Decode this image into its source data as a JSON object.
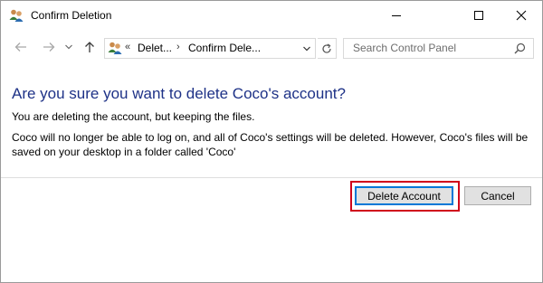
{
  "window": {
    "title": "Confirm Deletion",
    "controls": [
      "minimize",
      "maximize",
      "close"
    ]
  },
  "navigation": {
    "back_icon": "back-arrow-icon",
    "forward_icon": "forward-arrow-icon",
    "recent_icon": "chevron-down-icon",
    "up_icon": "up-arrow-icon",
    "address": {
      "overflow": "«",
      "crumbs": [
        "Delet...",
        "Confirm Dele..."
      ]
    },
    "search": {
      "placeholder": "Search Control Panel"
    }
  },
  "content": {
    "heading": "Are you sure you want to delete Coco's account?",
    "subtext": "You are deleting the account, but keeping the files.",
    "body": "Coco will no longer be able to log on, and all of Coco's settings will be deleted. However, Coco's files will be saved on your desktop in a folder called 'Coco'"
  },
  "buttons": {
    "delete_label": "Delete Account",
    "cancel_label": "Cancel"
  },
  "colors": {
    "heading": "#1e3287",
    "highlight": "#d0021b",
    "focus": "#0078d7"
  }
}
